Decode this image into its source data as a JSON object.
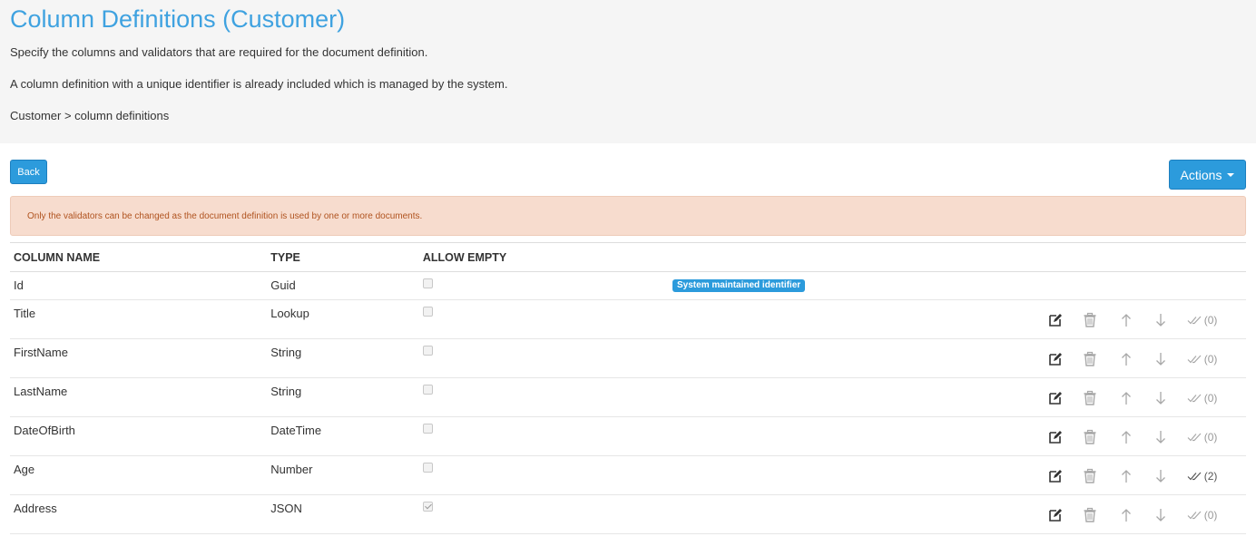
{
  "header": {
    "title": "Column Definitions (Customer)",
    "description_1": "Specify the columns and validators that are required for the document definition.",
    "description_2": "A column definition with a unique identifier is already included which is managed by the system.",
    "breadcrumb": "Customer > column definitions"
  },
  "toolbar": {
    "back_label": "Back",
    "actions_label": "Actions"
  },
  "alert": {
    "message": "Only the validators can be changed as the document definition is used by one or more documents."
  },
  "table": {
    "headers": {
      "column_name": "COLUMN NAME",
      "type": "TYPE",
      "allow_empty": "ALLOW EMPTY"
    },
    "id_row": {
      "name": "Id",
      "type": "Guid",
      "allow_empty": false,
      "badge": "System maintained identifier"
    },
    "rows": [
      {
        "name": "Title",
        "type": "Lookup",
        "allow_empty": false,
        "validators": "(0)"
      },
      {
        "name": "FirstName",
        "type": "String",
        "allow_empty": false,
        "validators": "(0)"
      },
      {
        "name": "LastName",
        "type": "String",
        "allow_empty": false,
        "validators": "(0)"
      },
      {
        "name": "DateOfBirth",
        "type": "DateTime",
        "allow_empty": false,
        "validators": "(0)"
      },
      {
        "name": "Age",
        "type": "Number",
        "allow_empty": false,
        "validators": "(2)"
      },
      {
        "name": "Address",
        "type": "JSON",
        "allow_empty": true,
        "validators": "(0)"
      }
    ]
  },
  "colors": {
    "accent": "#2c9bdc",
    "title": "#3fa2e0",
    "alert_bg": "#f7dcce",
    "alert_text": "#b0531f"
  },
  "icons": {
    "edit": "edit-icon",
    "delete": "trash-icon",
    "move_up": "arrow-up-icon",
    "move_down": "arrow-down-icon",
    "validators": "double-check-icon"
  }
}
